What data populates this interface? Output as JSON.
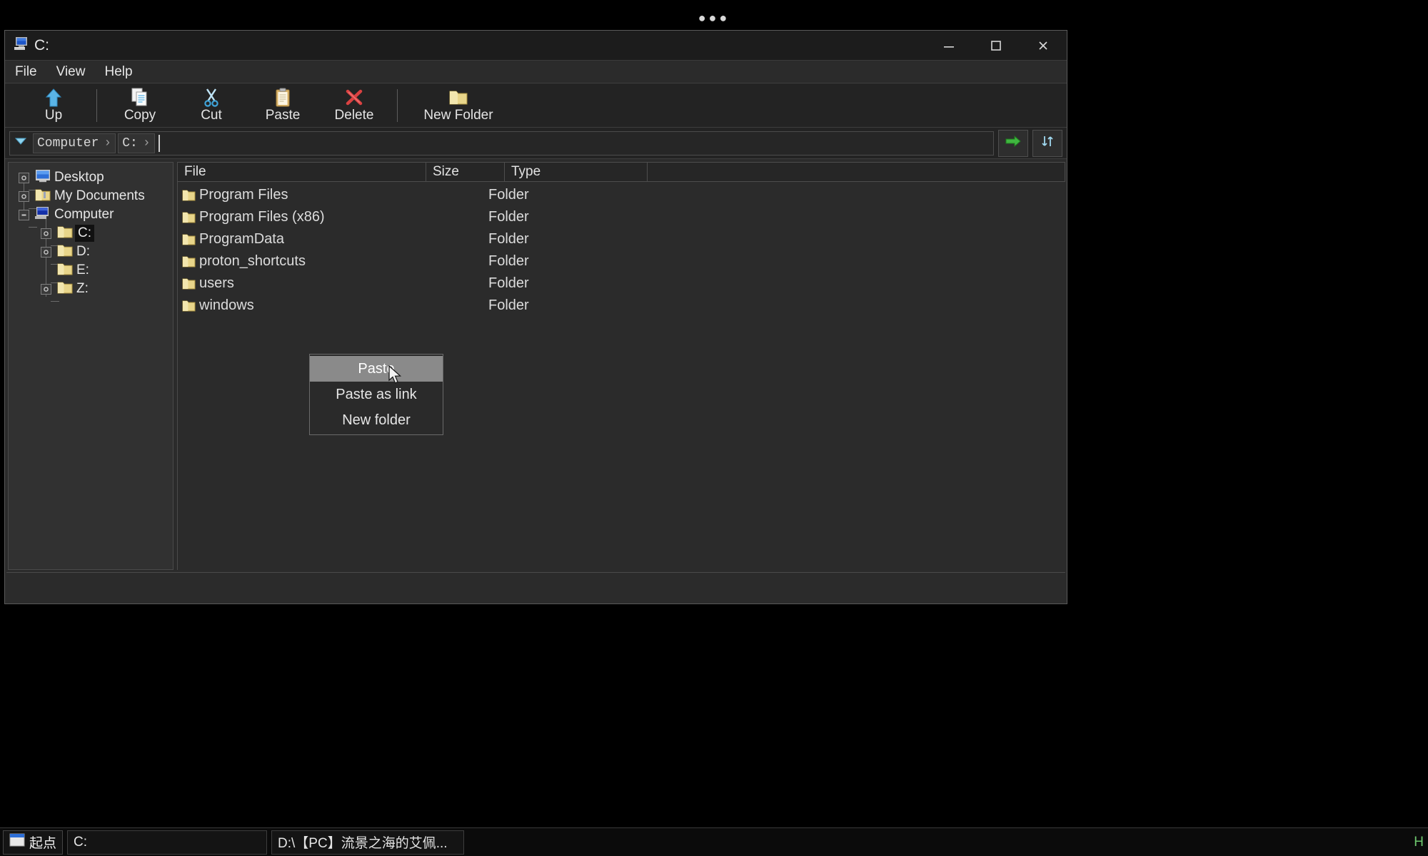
{
  "window": {
    "title": "C:",
    "title_icon": "computer-icon",
    "buttons": {
      "minimize": "—",
      "maximize": "□",
      "close": "✕"
    }
  },
  "menubar": {
    "items": [
      {
        "label": "File"
      },
      {
        "label": "View"
      },
      {
        "label": "Help"
      }
    ]
  },
  "toolbar": {
    "items": [
      {
        "label": "Up",
        "icon": "up-arrow-icon"
      },
      {
        "label": "Copy",
        "icon": "copy-icon"
      },
      {
        "label": "Cut",
        "icon": "scissors-icon"
      },
      {
        "label": "Paste",
        "icon": "clipboard-icon"
      },
      {
        "label": "Delete",
        "icon": "red-x-icon"
      },
      {
        "label": "New Folder",
        "icon": "folder-icon"
      }
    ]
  },
  "addressbar": {
    "dropdown_icon": "chevron-down-icon",
    "crumbs": [
      {
        "label": "Computer",
        "sep": "›"
      },
      {
        "label": "C:",
        "sep": "›"
      }
    ],
    "go_icon": "green-arrow-icon",
    "refresh_icon": "refresh-icon"
  },
  "tree": {
    "nodes": [
      {
        "label": "Desktop",
        "icon": "desktop-icon",
        "toggle": "+",
        "depth": 0,
        "selected": false
      },
      {
        "label": "My Documents",
        "icon": "folder-icon",
        "toggle": "+",
        "depth": 0,
        "selected": false
      },
      {
        "label": "Computer",
        "icon": "computer-icon",
        "toggle": "-",
        "depth": 0,
        "selected": false
      },
      {
        "label": "C:",
        "icon": "folder-icon",
        "toggle": "+",
        "depth": 1,
        "selected": true
      },
      {
        "label": "D:",
        "icon": "folder-icon",
        "toggle": "+",
        "depth": 1,
        "selected": false
      },
      {
        "label": "E:",
        "icon": "folder-icon",
        "toggle": "",
        "depth": 1,
        "selected": false
      },
      {
        "label": "Z:",
        "icon": "folder-icon",
        "toggle": "+",
        "depth": 1,
        "selected": false
      }
    ]
  },
  "filelist": {
    "columns": [
      {
        "label": "File"
      },
      {
        "label": "Size"
      },
      {
        "label": "Type"
      },
      {
        "label": ""
      }
    ],
    "rows": [
      {
        "name": "Program Files",
        "size": "",
        "type": "Folder",
        "icon": "folder-icon"
      },
      {
        "name": "Program Files (x86)",
        "size": "",
        "type": "Folder",
        "icon": "folder-icon"
      },
      {
        "name": "ProgramData",
        "size": "",
        "type": "Folder",
        "icon": "folder-icon"
      },
      {
        "name": "proton_shortcuts",
        "size": "",
        "type": "Folder",
        "icon": "folder-icon"
      },
      {
        "name": "users",
        "size": "",
        "type": "Folder",
        "icon": "folder-icon"
      },
      {
        "name": "windows",
        "size": "",
        "type": "Folder",
        "icon": "folder-icon"
      }
    ]
  },
  "context_menu": {
    "items": [
      {
        "label": "Paste",
        "highlighted": true
      },
      {
        "label": "Paste as link",
        "highlighted": false
      },
      {
        "label": "New folder",
        "highlighted": false
      }
    ]
  },
  "taskbar": {
    "start_label": "起点",
    "start_icon": "start-icon",
    "tasks": [
      {
        "label": "C:"
      },
      {
        "label": "D:\\【PC】流景之海的艾佩..."
      }
    ],
    "tray_label": "H"
  },
  "colors": {
    "window_bg": "#2b2b2b",
    "titlebar_bg": "#1c1c1c",
    "folder_yellow": "#e8d58a",
    "accent_blue": "#5ab4e6",
    "delete_red": "#d94141",
    "highlight_gray": "#8a8a8a",
    "go_green": "#3fb63f"
  }
}
